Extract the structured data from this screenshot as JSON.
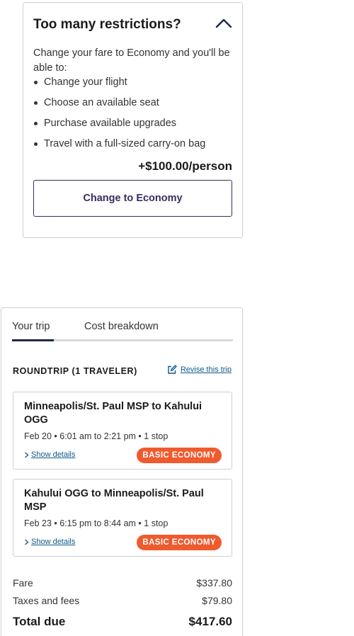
{
  "restrictions": {
    "title": "Too many restrictions?",
    "intro": "Change your fare to Economy and you'll be able to:",
    "benefits": [
      "Change your flight",
      "Choose an available seat",
      "Purchase available upgrades",
      "Travel with a full-sized carry-on bag"
    ],
    "price": "+$100.00/person",
    "button_label": "Change to Economy",
    "collapse_icon": "chevron-up-icon"
  },
  "trip": {
    "tabs": [
      {
        "label": "Your trip",
        "active": true
      },
      {
        "label": "Cost breakdown",
        "active": false
      }
    ],
    "summary_label": "ROUNDTRIP (1 TRAVELER)",
    "revise_label": "Revise this trip",
    "revise_icon": "edit-icon",
    "flights": [
      {
        "route": "Minneapolis/St. Paul MSP to Kahului OGG",
        "info": "Feb 20 • 6:01 am to 2:21 pm • 1 stop",
        "details_label": "Show details",
        "badge": "BASIC ECONOMY"
      },
      {
        "route": "Kahului OGG to Minneapolis/St. Paul MSP",
        "info": "Feb 23 • 6:15 pm to 8:44 am • 1 stop",
        "details_label": "Show details",
        "badge": "BASIC ECONOMY"
      }
    ],
    "costs": {
      "fare_label": "Fare",
      "fare_value": "$337.80",
      "taxes_label": "Taxes and fees",
      "taxes_value": "$79.80",
      "total_label": "Total due",
      "total_value": "$417.60"
    }
  },
  "colors": {
    "brand_purple": "#3a2d5c",
    "link_blue": "#0e5a87",
    "badge_orange": "#ef5a2e",
    "tab_indicator": "#1c2a47"
  }
}
